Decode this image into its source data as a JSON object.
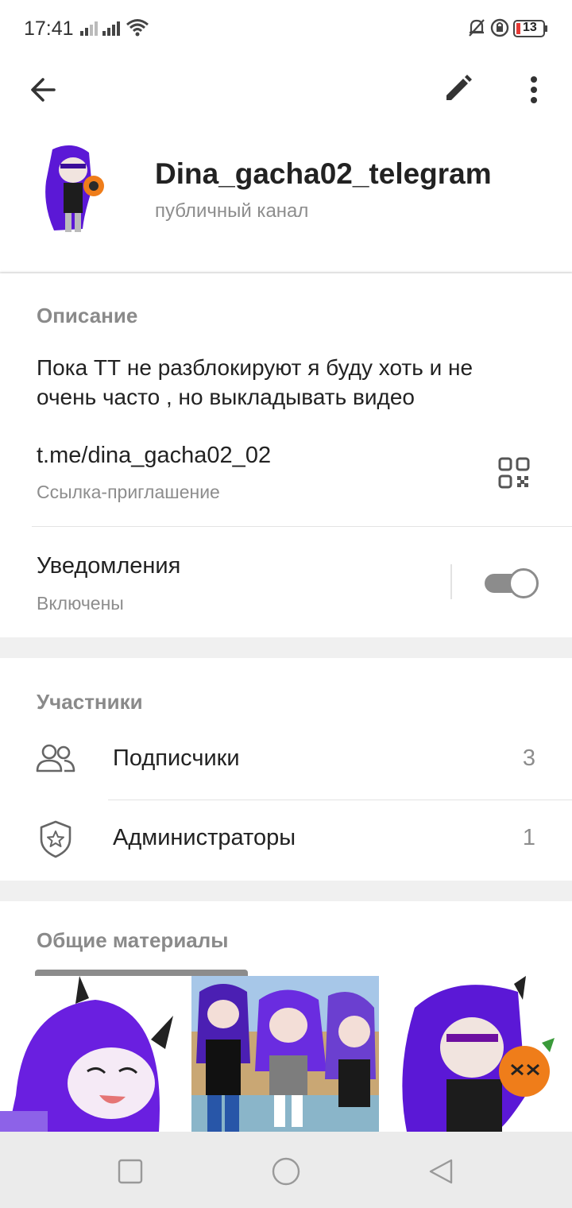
{
  "status_bar": {
    "time": "17:41",
    "battery": "13",
    "icons": [
      "signal-icon",
      "signal-icon",
      "wifi-icon",
      "bell-off-icon",
      "lock-rotation-icon",
      "battery-icon"
    ]
  },
  "app_bar": {
    "icons": [
      "back-arrow-icon",
      "pencil-icon",
      "more-vertical-icon"
    ]
  },
  "profile": {
    "name": "Dina_gacha02_telegram",
    "type": "публичный канал"
  },
  "info": {
    "description_title": "Описание",
    "description": "Пока ТТ не разблокируют я буду хоть и не очень часто , но выкладывать видео",
    "link": "t.me/dina_gacha02_02",
    "link_label": "Ссылка-приглашение",
    "notifications_title": "Уведомления",
    "notifications_status": "Включены",
    "notifications_on": true
  },
  "members": {
    "title": "Участники",
    "rows": [
      {
        "label": "Подписчики",
        "count": "3",
        "icon": "people-icon"
      },
      {
        "label": "Администраторы",
        "count": "1",
        "icon": "shield-star-icon"
      }
    ]
  },
  "media": {
    "title": "Общие материалы"
  },
  "colors": {
    "accent_purple": "#6a1fe0",
    "muted_text": "#8d8d8d",
    "toggle": "#8c8c8c",
    "battery_low": "#e53935"
  },
  "nav_bar": {
    "icons": [
      "recents-square-icon",
      "home-circle-icon",
      "back-triangle-icon"
    ]
  }
}
